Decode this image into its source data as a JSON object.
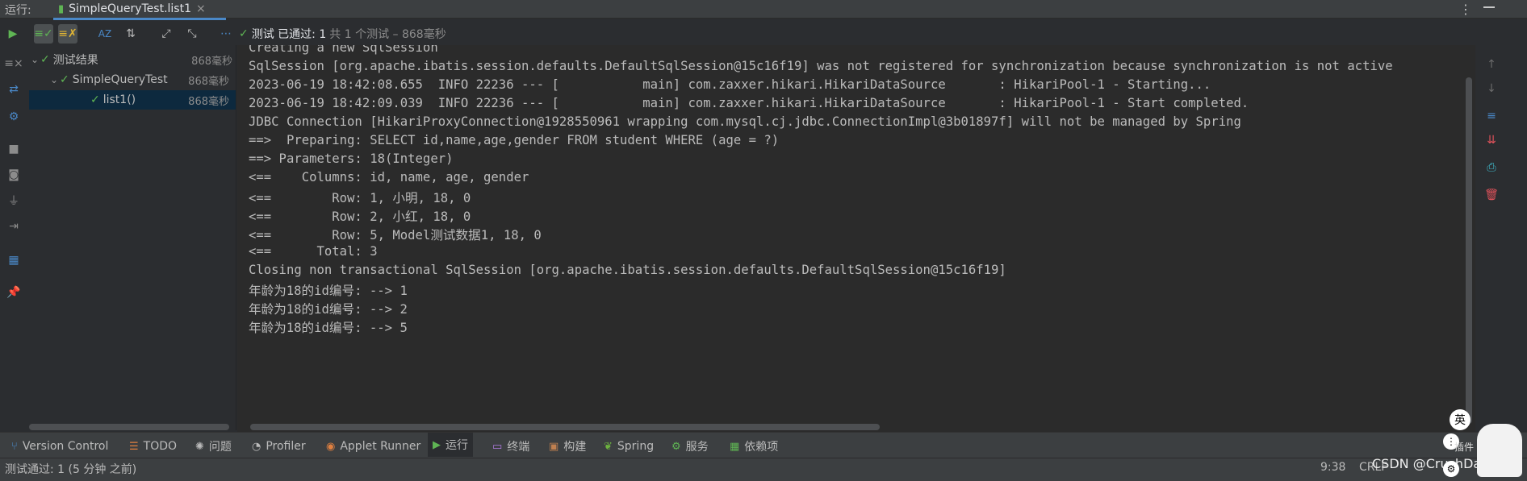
{
  "run_bar": {
    "label": "运行:",
    "tab_title": "SimpleQueryTest.list1",
    "close_glyph": "×"
  },
  "toolbar": {
    "status_title": "测试 已通过: 1",
    "status_detail": "共 1 个测试 – 868毫秒",
    "icons": [
      "run-icon",
      "show-passed-icon",
      "show-ignored-icon",
      "sort-alpha-icon",
      "sort-duration-icon",
      "expand-all-icon",
      "collapse-all-icon",
      "more-icon"
    ]
  },
  "tree": {
    "items": [
      {
        "label": "测试结果",
        "time": "868毫秒"
      },
      {
        "label": "SimpleQueryTest",
        "time": "868毫秒"
      },
      {
        "label": "list1()",
        "time": "868毫秒"
      }
    ]
  },
  "console": {
    "lines": [
      "Creating a new SqlSession",
      "SqlSession [org.apache.ibatis.session.defaults.DefaultSqlSession@15c16f19] was not registered for synchronization because synchronization is not active",
      "2023-06-19 18:42:08.655  INFO 22236 --- [           main] com.zaxxer.hikari.HikariDataSource       : HikariPool-1 - Starting...",
      "2023-06-19 18:42:09.039  INFO 22236 --- [           main] com.zaxxer.hikari.HikariDataSource       : HikariPool-1 - Start completed.",
      "JDBC Connection [HikariProxyConnection@1928550961 wrapping com.mysql.cj.jdbc.ConnectionImpl@3b01897f] will not be managed by Spring",
      "==>  Preparing: SELECT id,name,age,gender FROM student WHERE (age = ?)",
      "==> Parameters: 18(Integer)",
      "<==    Columns: id, name, age, gender",
      "<==        Row: 1, 小明, 18, 0",
      "<==        Row: 2, 小红, 18, 0",
      "<==        Row: 5, Model测试数据1, 18, 0",
      "<==      Total: 3",
      "Closing non transactional SqlSession [org.apache.ibatis.session.defaults.DefaultSqlSession@15c16f19]",
      "年龄为18的id编号: --> 1",
      "年龄为18的id编号: --> 2",
      "年龄为18的id编号: --> 5"
    ]
  },
  "bottom_tools": [
    {
      "label": "Version Control",
      "icon": "branch-icon"
    },
    {
      "label": "TODO",
      "icon": "todo-icon"
    },
    {
      "label": "问题",
      "icon": "problems-icon"
    },
    {
      "label": "Profiler",
      "icon": "profiler-icon"
    },
    {
      "label": "Applet Runner",
      "icon": "applet-icon"
    },
    {
      "label": "运行",
      "icon": "run-icon"
    },
    {
      "label": "终端",
      "icon": "terminal-icon"
    },
    {
      "label": "构建",
      "icon": "build-icon"
    },
    {
      "label": "Spring",
      "icon": "spring-icon"
    },
    {
      "label": "服务",
      "icon": "services-icon"
    },
    {
      "label": "依赖项",
      "icon": "dependencies-icon"
    }
  ],
  "status_bar": {
    "message": "测试通过: 1 (5 分钟 之前)",
    "caret": "9:38",
    "line_sep": "CRLF",
    "plugin": "插件",
    "ime": "英",
    "watermark": "CSDN @CrushDancing"
  },
  "colors": {
    "accent": "#4a88c7",
    "pass": "#5fb554",
    "selection": "#0d293e"
  }
}
